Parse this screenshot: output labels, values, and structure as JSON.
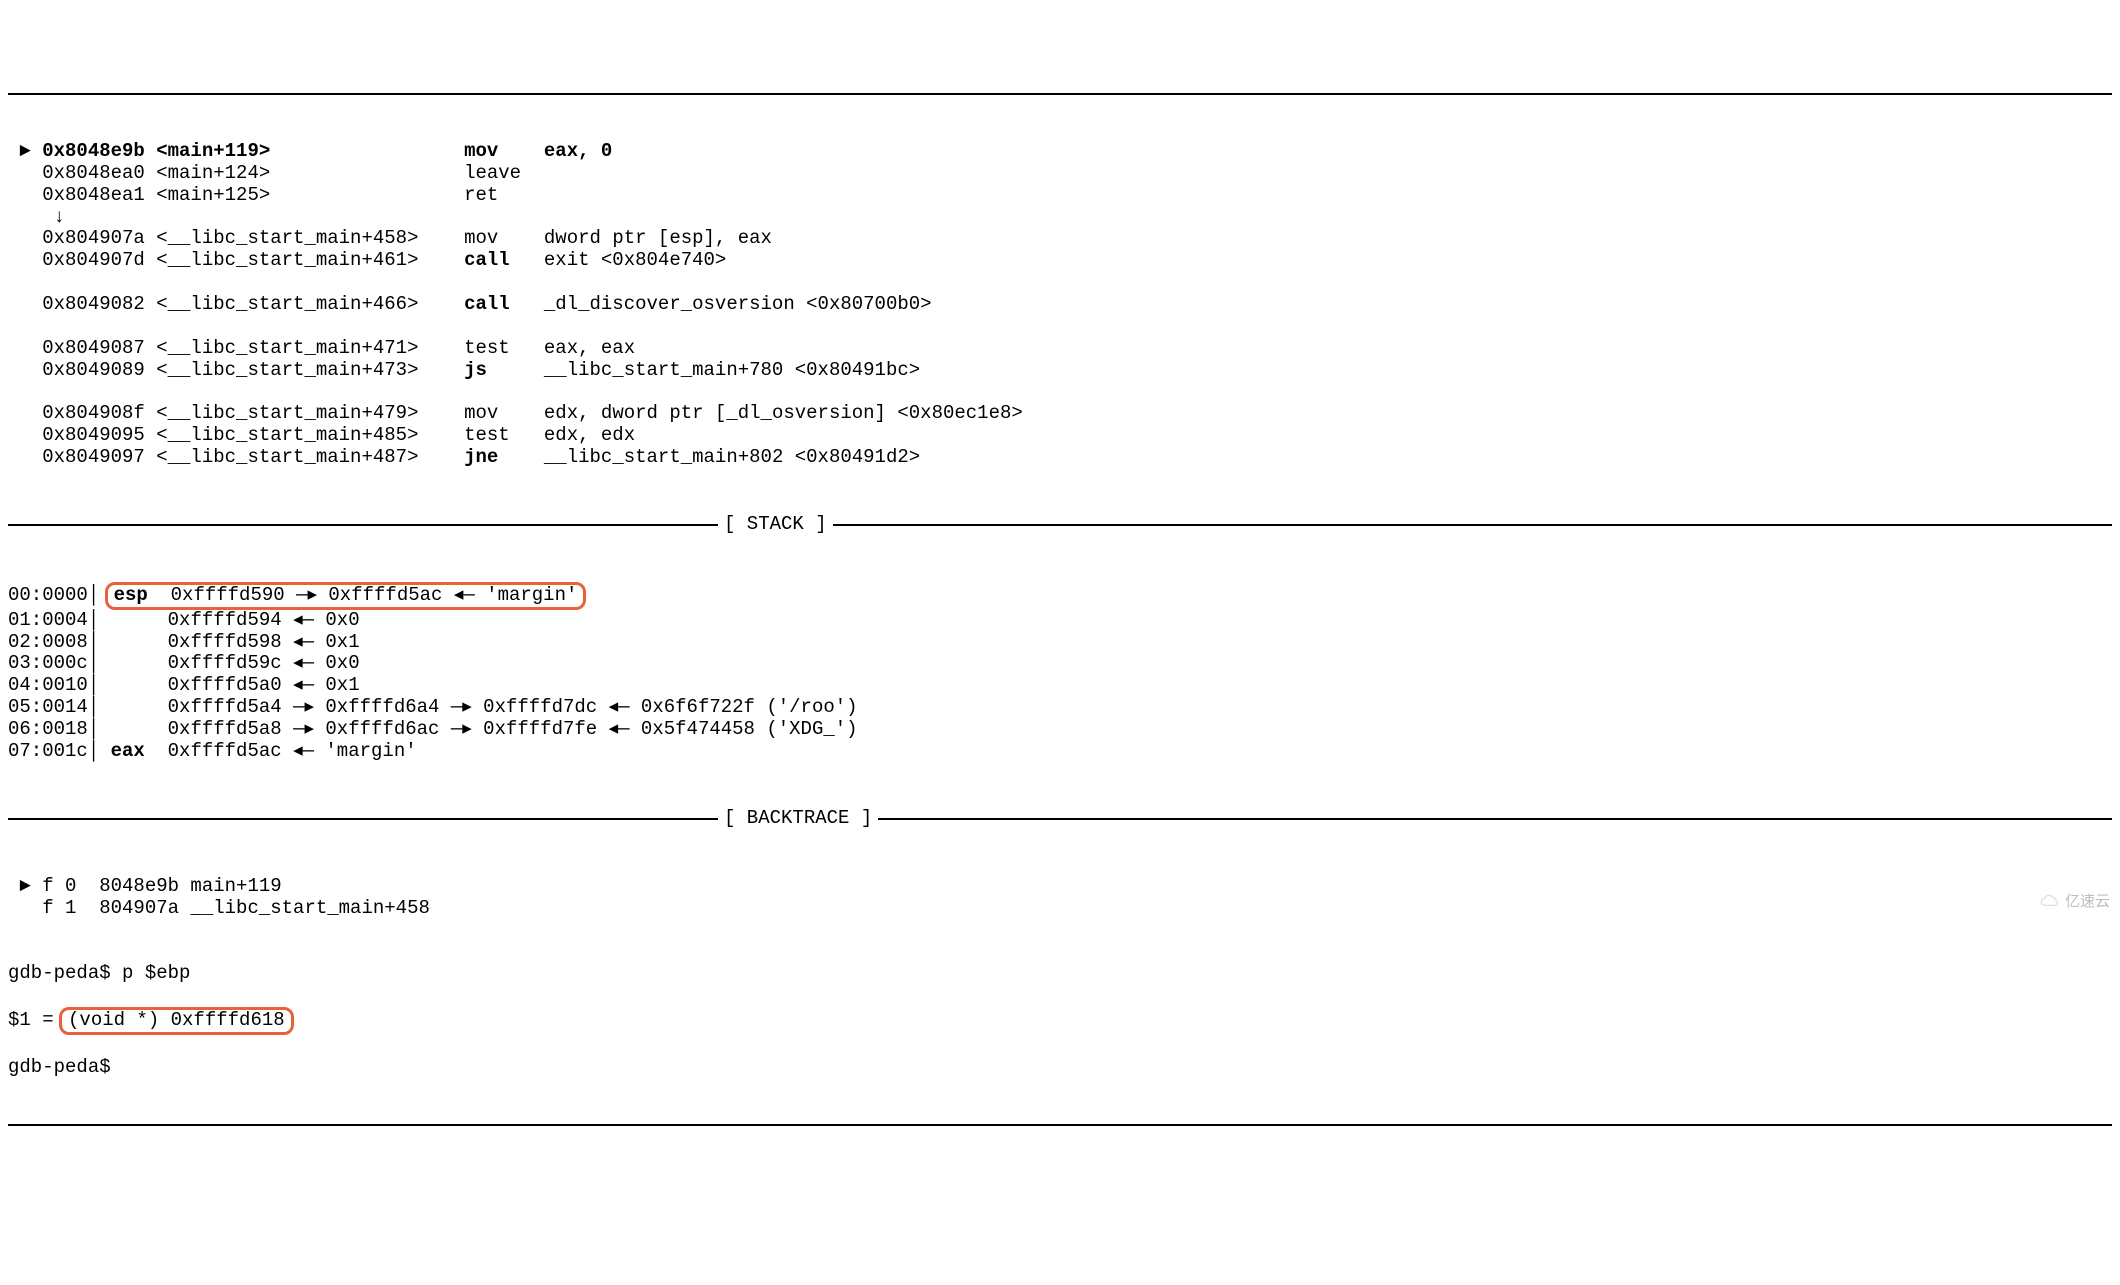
{
  "disasm": [
    {
      "marker": " ► ",
      "addr": "0x8048e9b",
      "loc": "<main+119>",
      "mn": "mov",
      "ops": "eax, 0",
      "bold": true,
      "indent": false
    },
    {
      "marker": "   ",
      "addr": "0x8048ea0",
      "loc": "<main+124>",
      "mn": "leave",
      "ops": "",
      "bold": false,
      "indent": false
    },
    {
      "marker": "   ",
      "addr": "0x8048ea1",
      "loc": "<main+125>",
      "mn": "ret",
      "ops": "",
      "bold": false,
      "indent": false
    },
    {
      "marker": "    ↓",
      "addr": "",
      "loc": "",
      "mn": "",
      "ops": "",
      "bold": false,
      "indent": false
    },
    {
      "marker": "   ",
      "addr": "0x804907a",
      "loc": "<__libc_start_main+458>",
      "mn": "mov",
      "ops": "dword ptr [esp], eax",
      "bold": false,
      "indent": false
    },
    {
      "marker": "   ",
      "addr": "0x804907d",
      "loc": "<__libc_start_main+461>",
      "mn": "call",
      "ops": "exit <0x804e740>",
      "bold": false,
      "mnbold": true,
      "indent": false
    },
    {
      "marker": " ",
      "addr": "",
      "loc": "",
      "mn": "",
      "ops": "",
      "bold": false,
      "indent": false
    },
    {
      "marker": "   ",
      "addr": "0x8049082",
      "loc": "<__libc_start_main+466>",
      "mn": "call",
      "ops": "_dl_discover_osversion <0x80700b0>",
      "bold": false,
      "mnbold": true,
      "indent": false
    },
    {
      "marker": " ",
      "addr": "",
      "loc": "",
      "mn": "",
      "ops": "",
      "bold": false,
      "indent": false
    },
    {
      "marker": "   ",
      "addr": "0x8049087",
      "loc": "<__libc_start_main+471>",
      "mn": "test",
      "ops": "eax, eax",
      "bold": false,
      "indent": false
    },
    {
      "marker": "   ",
      "addr": "0x8049089",
      "loc": "<__libc_start_main+473>",
      "mn": "js",
      "ops": "__libc_start_main+780 <0x80491bc>",
      "bold": false,
      "mnbold": true,
      "indent": false
    },
    {
      "marker": " ",
      "addr": "",
      "loc": "",
      "mn": "",
      "ops": "",
      "bold": false,
      "indent": false
    },
    {
      "marker": "   ",
      "addr": "0x804908f",
      "loc": "<__libc_start_main+479>",
      "mn": "mov",
      "ops": "edx, dword ptr [_dl_osversion] <0x80ec1e8>",
      "bold": false,
      "indent": false
    },
    {
      "marker": "   ",
      "addr": "0x8049095",
      "loc": "<__libc_start_main+485>",
      "mn": "test",
      "ops": "edx, edx",
      "bold": false,
      "indent": false
    },
    {
      "marker": "   ",
      "addr": "0x8049097",
      "loc": "<__libc_start_main+487>",
      "mn": "jne",
      "ops": "__libc_start_main+802 <0x80491d2>",
      "bold": false,
      "mnbold": true,
      "indent": false
    }
  ],
  "section_stack": "[ STACK ]",
  "stack": [
    {
      "idx": "00:0000│ ",
      "reg": "esp",
      "rest": "  0xffffd590 —▸ 0xffffd5ac ◂— 'margin'",
      "hl": true,
      "regbold": true
    },
    {
      "idx": "01:0004│ ",
      "reg": "   ",
      "rest": "  0xffffd594 ◂— 0x0",
      "hl": false
    },
    {
      "idx": "02:0008│ ",
      "reg": "   ",
      "rest": "  0xffffd598 ◂— 0x1",
      "hl": false
    },
    {
      "idx": "03:000c│ ",
      "reg": "   ",
      "rest": "  0xffffd59c ◂— 0x0",
      "hl": false
    },
    {
      "idx": "04:0010│ ",
      "reg": "   ",
      "rest": "  0xffffd5a0 ◂— 0x1",
      "hl": false
    },
    {
      "idx": "05:0014│ ",
      "reg": "   ",
      "rest": "  0xffffd5a4 —▸ 0xffffd6a4 —▸ 0xffffd7dc ◂— 0x6f6f722f ('/roo')",
      "hl": false
    },
    {
      "idx": "06:0018│ ",
      "reg": "   ",
      "rest": "  0xffffd5a8 —▸ 0xffffd6ac —▸ 0xffffd7fe ◂— 0x5f474458 ('XDG_')",
      "hl": false
    },
    {
      "idx": "07:001c│ ",
      "reg": "eax",
      "rest": "  0xffffd5ac ◂— 'margin'",
      "hl": false,
      "regbold": true
    }
  ],
  "section_bt": "[ BACKTRACE ]",
  "backtrace": [
    " ► f 0  8048e9b main+119",
    "   f 1  804907a __libc_start_main+458"
  ],
  "prompt1": "gdb-peda$ ",
  "cmd1": "p $ebp",
  "result_prefix": "$1 = ",
  "result_value": "(void *) 0xffffd618",
  "prompt2": "gdb-peda$ ",
  "watermark": "亿速云"
}
